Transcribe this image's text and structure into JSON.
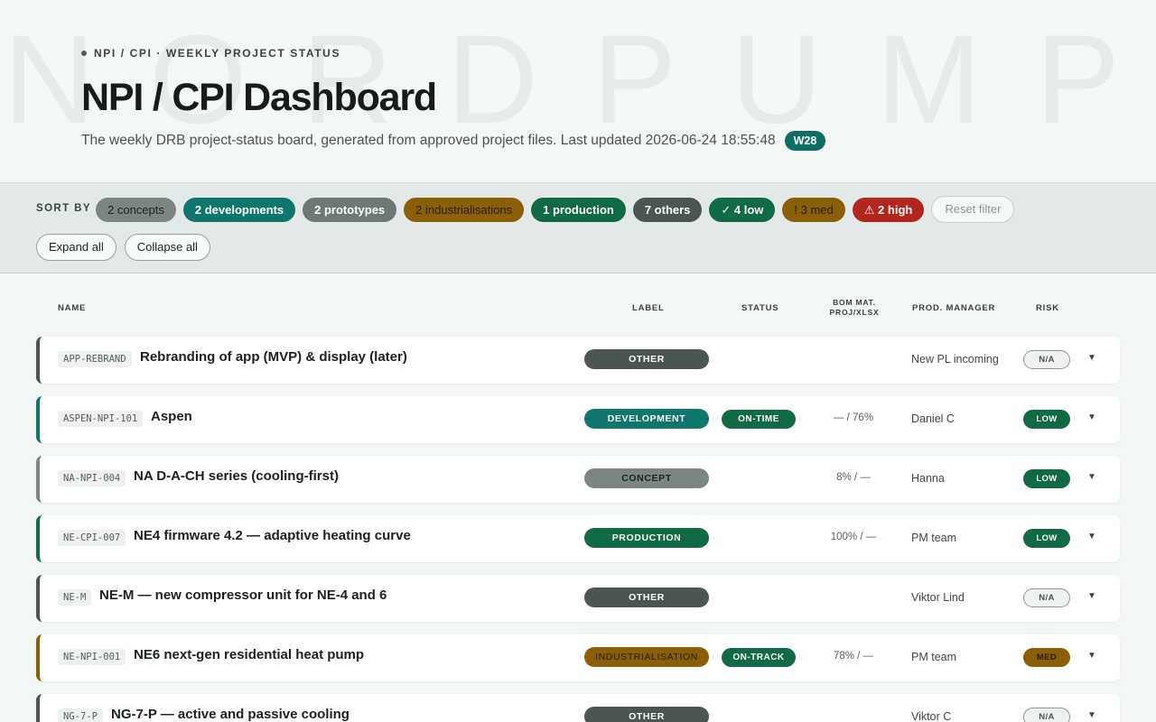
{
  "watermark": [
    "N",
    "O",
    "R",
    "D",
    "P",
    "U",
    "M",
    "P"
  ],
  "header": {
    "eyebrow": "NPI / CPI · WEEKLY PROJECT STATUS",
    "title": "NPI / CPI Dashboard",
    "subtitle": "The weekly DRB project-status board, generated from approved project files. Last updated 2026-06-24 18:55:48",
    "week": "W28"
  },
  "filters": {
    "sort_label": "SORT BY",
    "chips": [
      {
        "label": "2 concepts",
        "kind": "concept"
      },
      {
        "label": "2 developments",
        "kind": "dev"
      },
      {
        "label": "2 prototypes",
        "kind": "proto"
      },
      {
        "label": "2 industrialisations",
        "kind": "indus"
      },
      {
        "label": "1 production",
        "kind": "prod"
      },
      {
        "label": "7 others",
        "kind": "others"
      },
      {
        "label": "✓ 4 low",
        "kind": "low"
      },
      {
        "label": "! 3 med",
        "kind": "med"
      },
      {
        "label": "⚠ 2 high",
        "kind": "high"
      }
    ],
    "reset_label": "Reset filter",
    "expand_label": "Expand all",
    "collapse_label": "Collapse all"
  },
  "table": {
    "headers": {
      "name": "NAME",
      "label": "LABEL",
      "status": "STATUS",
      "bom_line1": "BOM MAT.",
      "bom_line2": "PROJ/XLSX",
      "pm": "PROD. MANAGER",
      "risk": "RISK"
    },
    "rows": [
      {
        "code": "APP-REBRAND",
        "name": "Rebranding of app (MVP) & display (later)",
        "label": "OTHER",
        "label_kind": "other",
        "status": "",
        "bom": "",
        "pm": "New PL incoming",
        "risk": "N/A",
        "risk_kind": "na",
        "accent": "#4b5553"
      },
      {
        "code": "ASPEN-NPI-101",
        "name": "Aspen",
        "label": "DEVELOPMENT",
        "label_kind": "development",
        "status": "ON-TIME",
        "bom": "— / 76%",
        "pm": "Daniel C",
        "risk": "LOW",
        "risk_kind": "low",
        "accent": "#0f766b"
      },
      {
        "code": "NA-NPI-004",
        "name": "NA D-A-CH series (cooling-first)",
        "label": "CONCEPT",
        "label_kind": "concept",
        "status": "",
        "bom": "8% / —",
        "pm": "Hanna",
        "risk": "LOW",
        "risk_kind": "low",
        "accent": "#7b8684"
      },
      {
        "code": "NE-CPI-007",
        "name": "NE4 firmware 4.2 — adaptive heating curve",
        "label": "PRODUCTION",
        "label_kind": "production",
        "status": "",
        "bom": "100% / —",
        "pm": "PM team",
        "risk": "LOW",
        "risk_kind": "low",
        "accent": "#0f6a45"
      },
      {
        "code": "NE-M",
        "name": "NE-M — new compressor unit for NE-4 and 6",
        "label": "OTHER",
        "label_kind": "other",
        "status": "",
        "bom": "",
        "pm": "Viktor Lind",
        "risk": "N/A",
        "risk_kind": "na",
        "accent": "#4b5553"
      },
      {
        "code": "NE-NPI-001",
        "name": "NE6 next-gen residential heat pump",
        "label": "INDUSTRIALISATION",
        "label_kind": "indus",
        "status": "ON-TRACK",
        "bom": "78% / —",
        "pm": "PM team",
        "risk": "MED",
        "risk_kind": "med",
        "accent": "#8a5f08"
      },
      {
        "code": "NG-7-P",
        "name": "NG-7-P — active and passive cooling",
        "label": "OTHER",
        "label_kind": "other",
        "status": "",
        "bom": "",
        "pm": "Viktor C",
        "risk": "N/A",
        "risk_kind": "na",
        "accent": "#4b5553"
      }
    ]
  }
}
